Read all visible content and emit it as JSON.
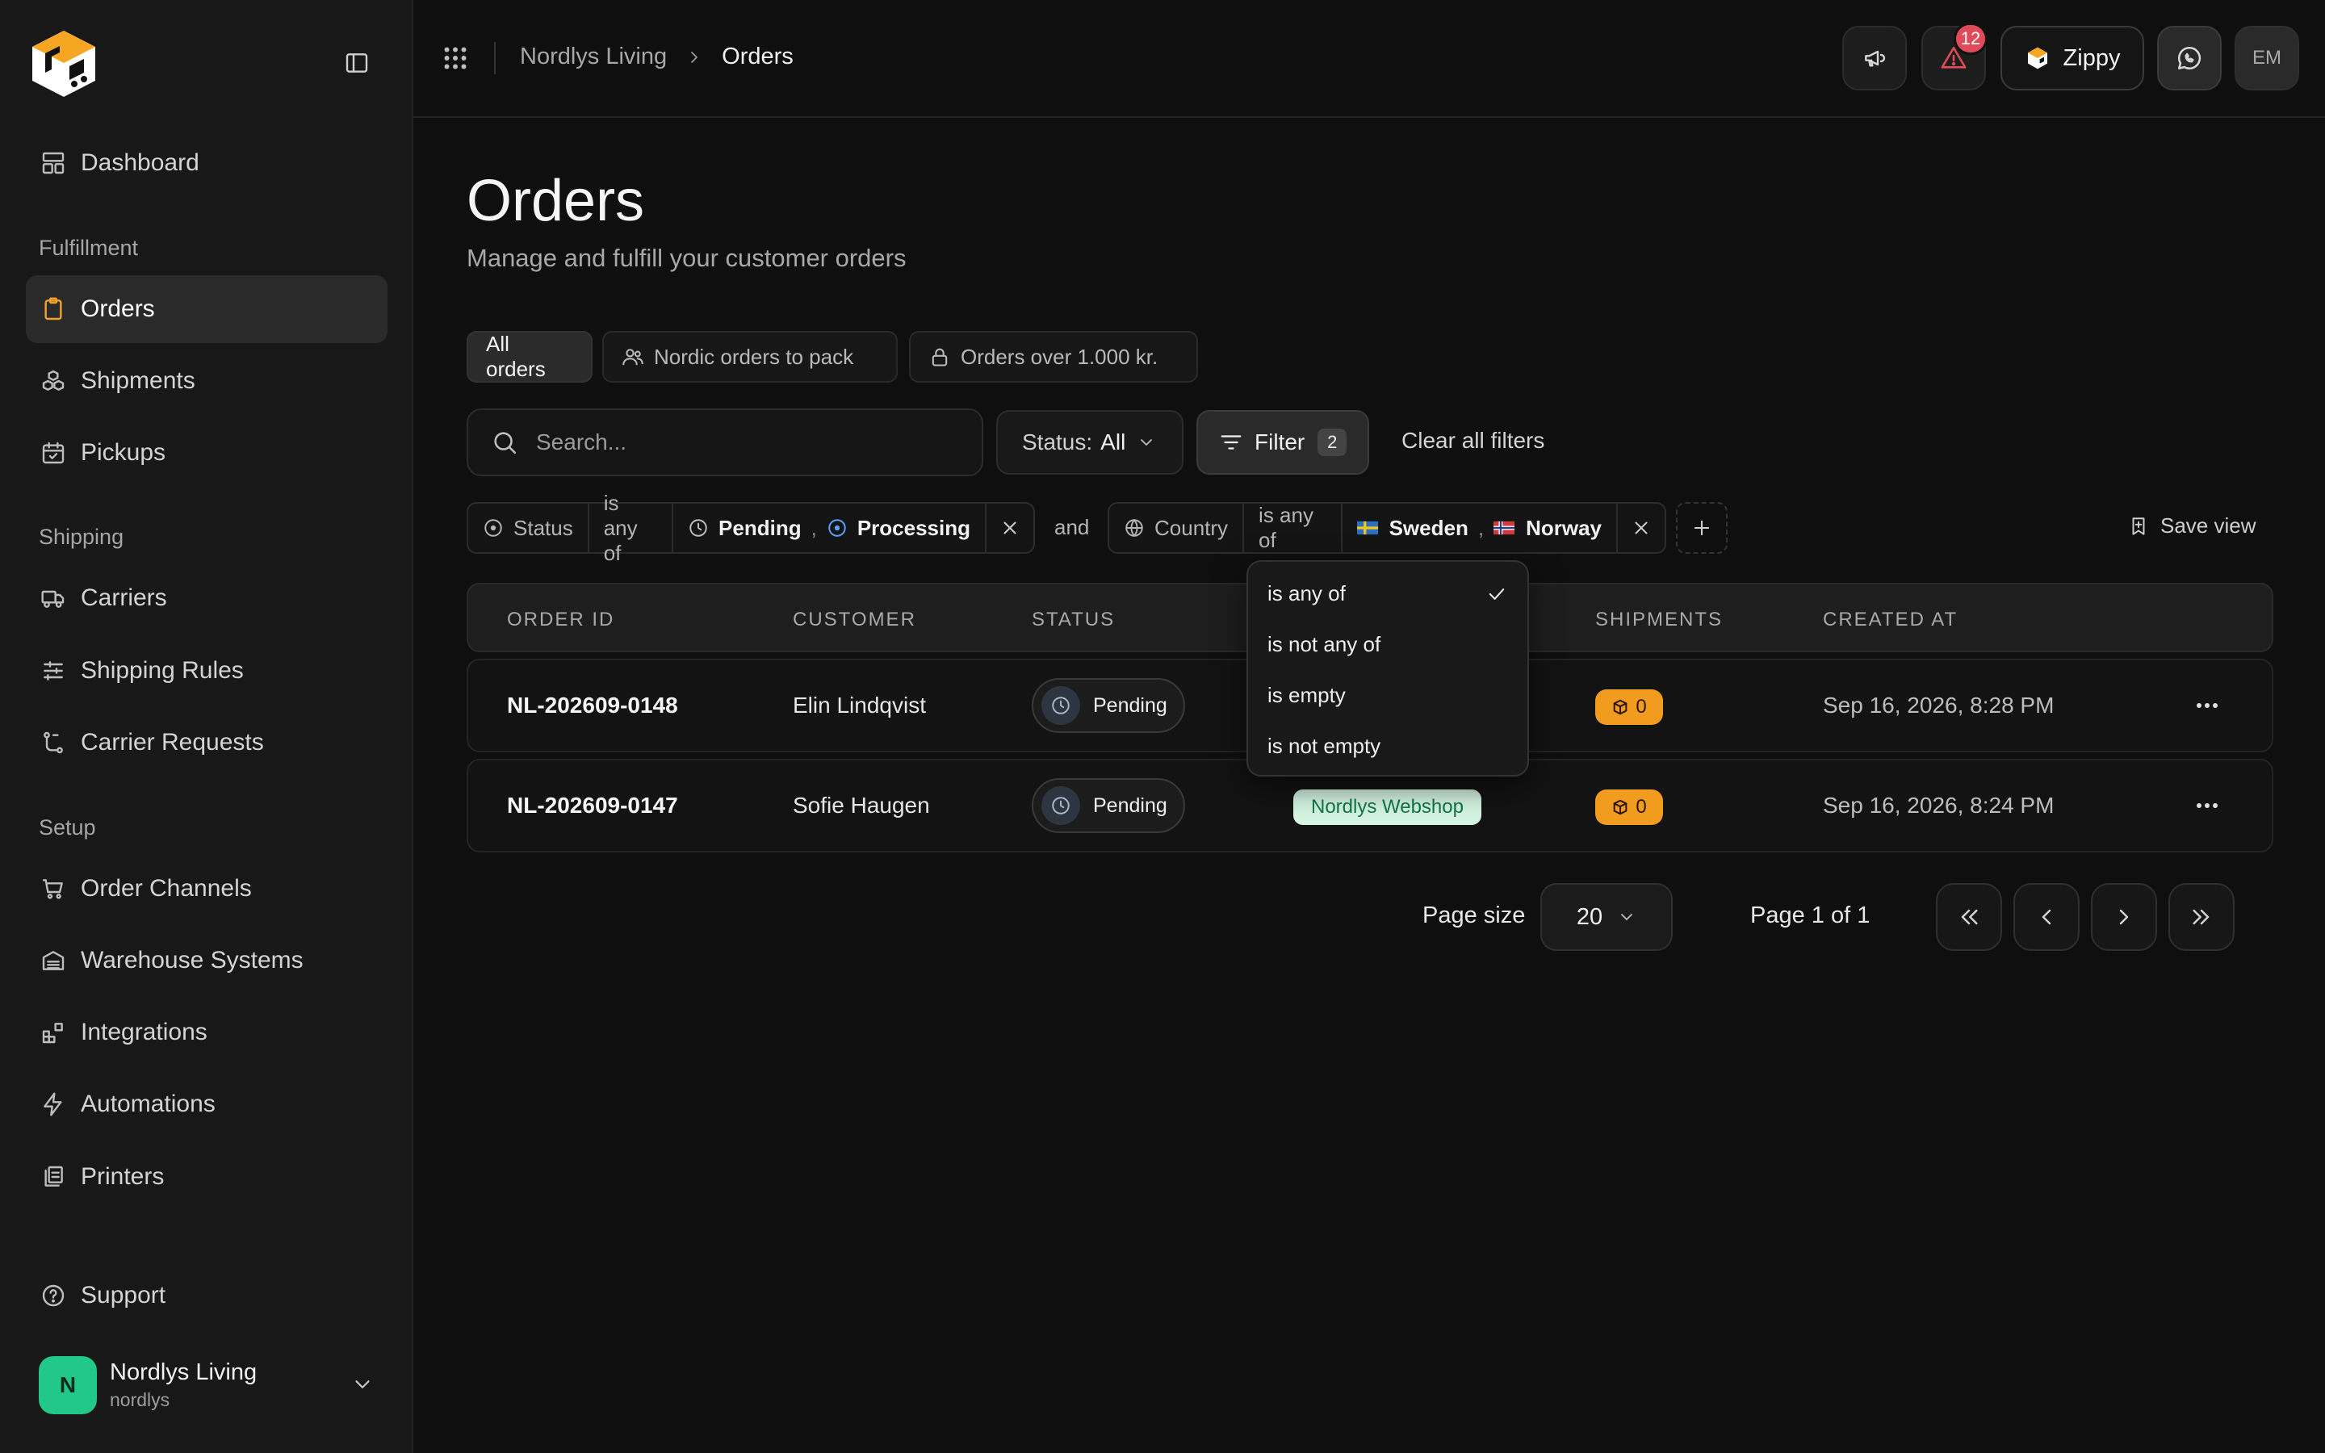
{
  "sidebar": {
    "items": [
      {
        "label": "Dashboard",
        "icon": "dashboard-icon"
      },
      {
        "label": "Orders",
        "icon": "clipboard-icon",
        "active": true
      },
      {
        "label": "Shipments",
        "icon": "boxes-icon"
      },
      {
        "label": "Pickups",
        "icon": "calendar-check-icon"
      },
      {
        "label": "Carriers",
        "icon": "truck-icon"
      },
      {
        "label": "Shipping Rules",
        "icon": "sliders-icon"
      },
      {
        "label": "Carrier Requests",
        "icon": "route-icon"
      },
      {
        "label": "Order Channels",
        "icon": "cart-icon"
      },
      {
        "label": "Warehouse Systems",
        "icon": "warehouse-icon"
      },
      {
        "label": "Integrations",
        "icon": "blocks-icon"
      },
      {
        "label": "Automations",
        "icon": "bolt-icon"
      },
      {
        "label": "Printers",
        "icon": "printer-stack-icon"
      },
      {
        "label": "Support",
        "icon": "help-circle-icon"
      }
    ],
    "sections": {
      "fulfillment": "Fulfillment",
      "shipping": "Shipping",
      "setup": "Setup"
    },
    "account": {
      "initial": "N",
      "name": "Nordlys Living",
      "handle": "nordlys"
    }
  },
  "topbar": {
    "breadcrumb": [
      "Nordlys Living",
      "Orders"
    ],
    "notification_count": "12",
    "workspace_label": "Zippy",
    "user_initials": "EM"
  },
  "main": {
    "title": "Orders",
    "subtitle": "Manage and fulfill your customer orders",
    "views": [
      "All orders",
      "Nordic orders to pack",
      "Orders over 1.000 kr."
    ],
    "search_placeholder": "Search...",
    "status_select": {
      "label": "Status:",
      "value": "All"
    },
    "filter_button": {
      "label": "Filter",
      "count": "2"
    },
    "clear_filters": "Clear all filters",
    "filters": {
      "status": {
        "field": "Status",
        "operator": "is any of",
        "values": [
          "Pending",
          "Processing"
        ]
      },
      "joiner": "and",
      "country": {
        "field": "Country",
        "operator": "is any of",
        "values": [
          "Sweden",
          "Norway"
        ]
      }
    },
    "save_view": "Save view"
  },
  "operator_menu": {
    "options": [
      "is any of",
      "is not any of",
      "is empty",
      "is not empty"
    ],
    "selected": "is any of"
  },
  "table": {
    "columns": [
      "ORDER ID",
      "CUSTOMER",
      "STATUS",
      "SHIPMENTS",
      "CREATED AT"
    ],
    "rows": [
      {
        "order_id": "NL-202609-0148",
        "customer": "Elin Lindqvist",
        "status": "Pending",
        "channel": "",
        "shipments": "0",
        "created_at": "Sep 16, 2026, 8:28 PM"
      },
      {
        "order_id": "NL-202609-0147",
        "customer": "Sofie Haugen",
        "status": "Pending",
        "channel": "Nordlys Webshop",
        "shipments": "0",
        "created_at": "Sep 16, 2026, 8:24 PM"
      }
    ]
  },
  "pagination": {
    "page_size_label": "Page size",
    "page_size": "20",
    "page_info": "Page 1 of 1"
  },
  "colors": {
    "accent": "#f0a22e",
    "badge_red": "#e14b59",
    "channel_green": "#d6f6e3",
    "shipments_orange": "#f29c1f",
    "avatar_green": "#22c78a"
  }
}
